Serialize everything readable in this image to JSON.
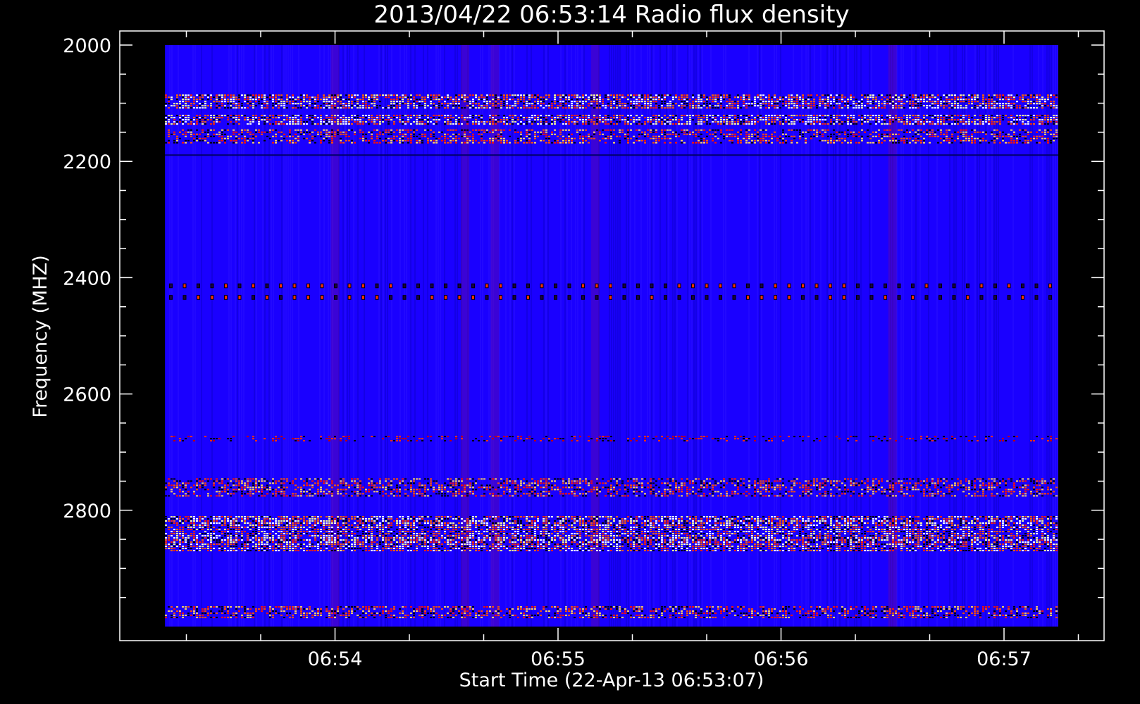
{
  "chart_data": {
    "type": "heatmap",
    "title": "2013/04/22 06:53:14 Radio flux density",
    "xlabel": "Start Time (22-Apr-13 06:53:07)",
    "ylabel": "Frequency (MHZ)",
    "x_ticks": [
      "06:54",
      "06:55",
      "06:56",
      "06:57"
    ],
    "y_ticks": [
      "2000",
      "2200",
      "2400",
      "2600",
      "2800"
    ],
    "y_range_mhz": [
      2000,
      3000
    ],
    "x_range": [
      "06:53:07",
      "06:57:15"
    ],
    "grid": false,
    "colormap": [
      "#000000",
      "#1a00ff",
      "#ff0000",
      "#ffff80",
      "#ffffff"
    ],
    "background_color": "#1a00ff",
    "emission_bands_mhz": [
      {
        "low": 2085,
        "high": 2110,
        "intensity": "strong"
      },
      {
        "low": 2120,
        "high": 2135,
        "intensity": "strong"
      },
      {
        "low": 2145,
        "high": 2170,
        "intensity": "medium"
      },
      {
        "low": 2188,
        "high": 2190,
        "intensity": "line"
      },
      {
        "low": 2410,
        "high": 2418,
        "intensity": "periodic"
      },
      {
        "low": 2430,
        "high": 2438,
        "intensity": "periodic"
      },
      {
        "low": 2672,
        "high": 2680,
        "intensity": "weak"
      },
      {
        "low": 2745,
        "high": 2775,
        "intensity": "medium"
      },
      {
        "low": 2810,
        "high": 2870,
        "intensity": "strong"
      },
      {
        "low": 2965,
        "high": 2985,
        "intensity": "medium"
      }
    ],
    "bursty_times": [
      "06:54:00",
      "06:54:35",
      "06:54:43",
      "06:55:10",
      "06:56:30"
    ]
  }
}
